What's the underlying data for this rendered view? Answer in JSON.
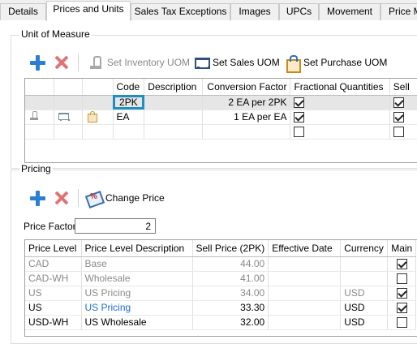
{
  "tabs": [
    {
      "label": "Details"
    },
    {
      "label": "Prices and Units",
      "active": true
    },
    {
      "label": "Sales Tax Exceptions"
    },
    {
      "label": "Images"
    },
    {
      "label": "UPCs"
    },
    {
      "label": "Movement"
    },
    {
      "label": "Price Ma"
    }
  ],
  "uom": {
    "group_label": "Unit of Measure",
    "toolbar": {
      "add_icon": "plus-icon",
      "delete_icon": "x-icon",
      "set_inventory_label": "Set Inventory UOM",
      "set_sales_label": "Set Sales UOM",
      "set_purchase_label": "Set Purchase UOM"
    },
    "columns": [
      "",
      "",
      "",
      "Code",
      "Description",
      "Conversion Factor",
      "Fractional Quantities",
      "Sell"
    ],
    "rows": [
      {
        "code": "2PK",
        "description": "",
        "conversion": "2 EA per 2PK",
        "fractional": true,
        "sell": true,
        "icons": []
      },
      {
        "code": "EA",
        "description": "",
        "conversion": "1 EA per EA",
        "fractional": true,
        "sell": true,
        "icons": [
          "scale-icon",
          "cart-icon",
          "bag-icon"
        ]
      },
      {
        "code": "",
        "description": "",
        "conversion": "",
        "fractional": false,
        "sell": false,
        "icons": []
      }
    ]
  },
  "pricing": {
    "group_label": "Pricing",
    "toolbar": {
      "add_icon": "plus-icon",
      "delete_icon": "x-icon",
      "change_price_label": "Change Price"
    },
    "price_factor_label": "Price Factor",
    "price_factor_value": "2",
    "columns": [
      "Price Level",
      "Price Level Description",
      "Sell Price (2PK)",
      "Effective Date",
      "Currency",
      "Main"
    ],
    "rows": [
      {
        "level": "CAD",
        "description": "Base",
        "price": "44.00",
        "date": "",
        "currency": "",
        "main": true,
        "style": "gray"
      },
      {
        "level": "CAD-WH",
        "description": "Wholesale",
        "price": "41.00",
        "date": "",
        "currency": "",
        "main": false,
        "style": "gray"
      },
      {
        "level": "US",
        "description": "US Pricing",
        "price": "34.00",
        "date": "",
        "currency": "USD",
        "main": true,
        "style": "gray"
      },
      {
        "level": "US",
        "description": "US Pricing",
        "price": "33.30",
        "date": "",
        "currency": "USD",
        "main": true,
        "style": "active"
      },
      {
        "level": "USD-WH",
        "description": "US Wholesale",
        "price": "32.00",
        "date": "",
        "currency": "USD",
        "main": false,
        "style": "normal"
      }
    ]
  }
}
